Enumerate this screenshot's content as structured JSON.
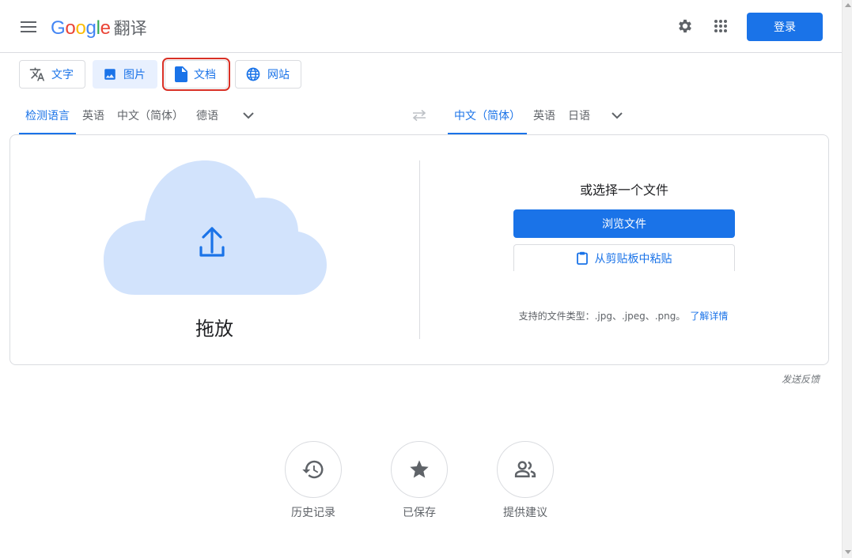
{
  "header": {
    "logo_word": [
      "G",
      "o",
      "o",
      "g",
      "l",
      "e"
    ],
    "product": "翻译",
    "login_label": "登录"
  },
  "modes": [
    {
      "label": "文字",
      "icon": "translate-icon",
      "state": "default"
    },
    {
      "label": "图片",
      "icon": "image-icon",
      "state": "active"
    },
    {
      "label": "文档",
      "icon": "document-icon",
      "state": "highlighted"
    },
    {
      "label": "网站",
      "icon": "globe-icon",
      "state": "default"
    }
  ],
  "source_langs": [
    "检测语言",
    "英语",
    "中文（简体）",
    "德语"
  ],
  "target_langs": [
    "中文（简体）",
    "英语",
    "日语"
  ],
  "upload": {
    "drop_label": "拖放",
    "choose_label": "或选择一个文件",
    "browse_label": "浏览文件",
    "paste_label": "从剪贴板中粘贴",
    "types_text": "支持的文件类型：.jpg、.jpeg、.png。",
    "learn_more": "了解详情"
  },
  "feedback": "发送反馈",
  "actions": [
    {
      "label": "历史记录",
      "icon": "history-icon"
    },
    {
      "label": "已保存",
      "icon": "star-icon"
    },
    {
      "label": "提供建议",
      "icon": "people-icon"
    }
  ],
  "colors": {
    "accent": "#1a73e8",
    "active_tab_bg": "#e8f0fe",
    "highlight_box": "#d93025",
    "cloud": "#d2e3fc"
  }
}
